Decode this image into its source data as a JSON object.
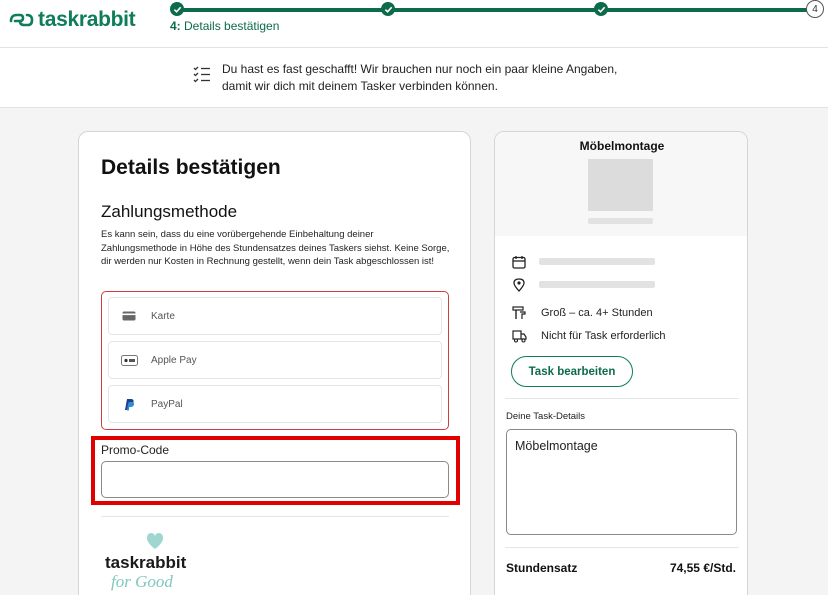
{
  "brand": {
    "name": "taskrabbit",
    "color": "#0d7d5a"
  },
  "progress": {
    "current_step": "4:",
    "current_label": "Details bestätigen",
    "last_step_number": "4"
  },
  "banner": {
    "icon": "checklist-icon",
    "text": "Du hast es fast geschafft! Wir brauchen nur noch ein paar kleine Angaben, damit wir dich mit deinem Tasker verbinden können."
  },
  "details": {
    "title": "Details bestätigen",
    "payment_heading": "Zahlungsmethode",
    "payment_description": "Es kann sein, dass du eine vorübergehende Einbehaltung deiner Zahlungsmethode in Höhe des Stundensatzes deines Taskers siehst. Keine Sorge, dir werden nur Kosten in Rechnung gestellt, wenn dein Task abgeschlossen ist!",
    "payment_options": [
      {
        "label": "Karte",
        "icon": "credit-card-icon"
      },
      {
        "label": "Apple Pay",
        "icon": "apple-pay-icon"
      },
      {
        "label": "PayPal",
        "icon": "paypal-icon"
      }
    ],
    "promo_label": "Promo-Code",
    "promo_value": "",
    "for_good_logo": {
      "name": "taskrabbit",
      "tagline": "for Good"
    }
  },
  "summary": {
    "title": "Möbelmontage",
    "rows": [
      {
        "icon": "calendar-icon",
        "text": ""
      },
      {
        "icon": "location-pin-icon",
        "text": ""
      },
      {
        "icon": "tools-icon",
        "text": "Groß – ca. 4+ Stunden"
      },
      {
        "icon": "truck-icon",
        "text": "Nicht für Task erforderlich"
      }
    ],
    "edit_button": "Task bearbeiten",
    "task_details_label": "Deine Task-Details",
    "task_details_value": "Möbelmontage",
    "rate_label": "Stundensatz",
    "rate_value": "74,55 €/Std."
  }
}
